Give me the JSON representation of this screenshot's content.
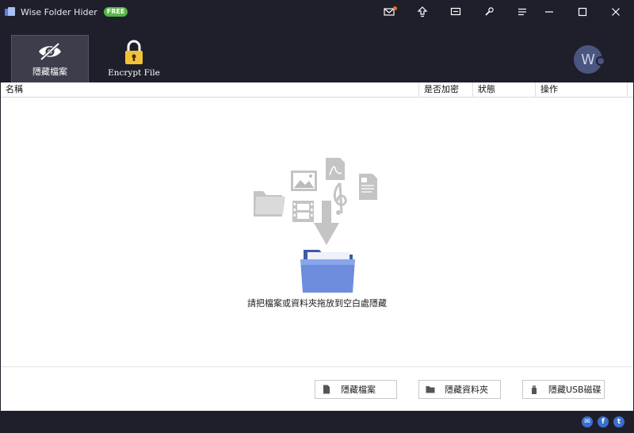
{
  "window": {
    "title": "Wise Folder Hider",
    "badge": "FREE"
  },
  "toolbar": {
    "tabs": [
      {
        "label": "隱藏檔案",
        "icon": "eye-slash-icon",
        "active": true
      },
      {
        "label": "Encrypt File",
        "icon": "padlock-icon",
        "active": false
      }
    ],
    "avatar_letter": "W"
  },
  "table": {
    "columns": [
      "名稱",
      "是否加密",
      "狀態",
      "操作"
    ]
  },
  "empty_state": {
    "message": "請把檔案或資料夾拖放到空白處隱藏"
  },
  "actions": {
    "hide_file": "隱藏檔案",
    "hide_folder": "隱藏資料夾",
    "hide_usb": "隱藏USB磁碟"
  },
  "colors": {
    "chrome_bg": "#1f1f2b",
    "badge_green": "#57b547",
    "folder_blue": "#5b7fd6",
    "notify_orange": "#ff6a2b"
  }
}
